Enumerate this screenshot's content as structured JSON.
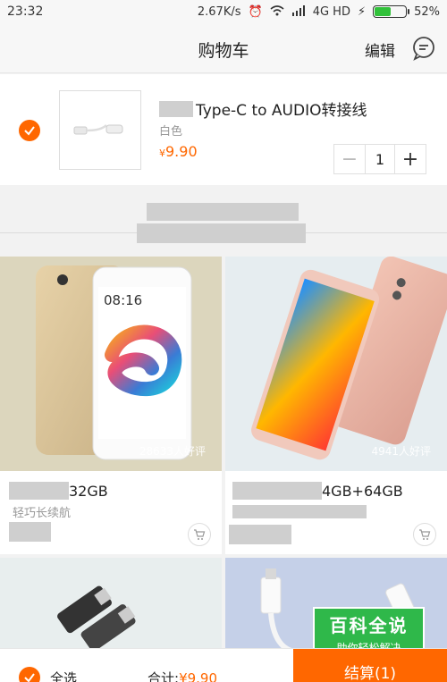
{
  "status_bar": {
    "time": "23:32",
    "speed": "2.67K/s",
    "network": "4G HD",
    "battery": "52%",
    "battery_level": 0.52
  },
  "header": {
    "title": "购物车",
    "edit_label": "编辑",
    "message_icon": "chat-bubble-icon"
  },
  "cart_item": {
    "name": "Type-C to AUDIO转接线",
    "spec": "白色",
    "price_symbol": "¥",
    "price": "9.90",
    "quantity": "1",
    "minus": "−",
    "plus": "+"
  },
  "products": [
    {
      "name": "32GB",
      "desc": "轻巧长续航",
      "reviews": "28633人好评"
    },
    {
      "name": "4GB+64GB",
      "desc": "",
      "reviews": "4941人好评"
    }
  ],
  "bottom_bar": {
    "select_all": "全选",
    "total_label": "合计:",
    "total_value": "¥9.90",
    "checkout_label": "结算(1)"
  },
  "watermark": {
    "title": "百科全说",
    "subtitle": "助你轻松解决"
  },
  "colors": {
    "accent": "#ff6700",
    "watermark_green": "#2fb84a"
  }
}
